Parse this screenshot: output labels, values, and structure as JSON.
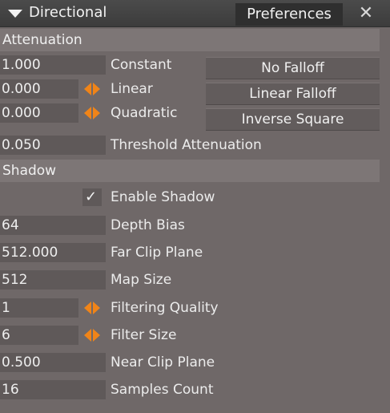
{
  "titlebar": {
    "title": "Directional",
    "preferences_tab": "Preferences",
    "close_glyph": "✕"
  },
  "attenuation": {
    "header": "Attenuation",
    "constant": {
      "value": "1.000",
      "label": "Constant"
    },
    "linear": {
      "value": "0.000",
      "label": "Linear"
    },
    "quadratic": {
      "value": "0.000",
      "label": "Quadratic"
    },
    "threshold": {
      "value": "0.050",
      "label": "Threshold Attenuation"
    },
    "buttons": {
      "no_falloff": "No Falloff",
      "linear_falloff": "Linear Falloff",
      "inverse_square": "Inverse Square"
    }
  },
  "shadow": {
    "header": "Shadow",
    "enable": {
      "label": "Enable Shadow",
      "checked": true,
      "check_glyph": "✓"
    },
    "depth_bias": {
      "value": "64",
      "label": "Depth Bias"
    },
    "far_clip_plane": {
      "value": "512.000",
      "label": "Far Clip Plane"
    },
    "map_size": {
      "value": "512",
      "label": "Map Size"
    },
    "filtering_quality": {
      "value": "1",
      "label": "Filtering Quality"
    },
    "filter_size": {
      "value": "6",
      "label": "Filter Size"
    },
    "near_clip_plane": {
      "value": "0.500",
      "label": "Near Clip Plane"
    },
    "samples_count": {
      "value": "16",
      "label": "Samples Count"
    }
  },
  "colors": {
    "panel_bg": "#6f6868",
    "accent_spinner": "#f08418",
    "titlebar_bg": "#3c3c3c"
  }
}
